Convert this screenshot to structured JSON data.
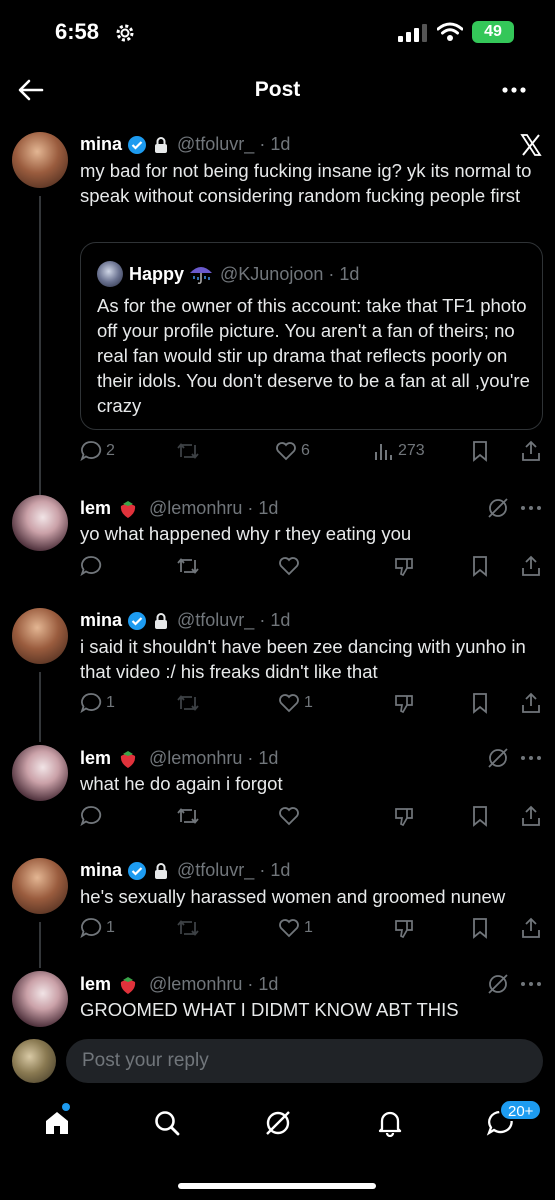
{
  "status": {
    "time": "6:58",
    "battery": "49"
  },
  "header": {
    "title": "Post"
  },
  "tweets": [
    {
      "name": "mina",
      "handle": "@tfoluvr_",
      "time": "1d",
      "text": "my bad for  not being fucking insane ig? yk its normal to speak without considering random fucking people first",
      "quote": {
        "name": "Happy",
        "handle": "@KJunojoon",
        "time": "1d",
        "text": "As for the owner of this account: take that TF1 photo off your profile picture. You aren't a fan of theirs; no real fan would stir up drama that reflects poorly on their idols. You don't deserve to be a fan at all ,you're crazy"
      },
      "replies": "2",
      "likes": "6",
      "views": "273"
    },
    {
      "name": "lem",
      "handle": "@lemonhru",
      "time": "1d",
      "text": "yo what happened why r they eating you"
    },
    {
      "name": "mina",
      "handle": "@tfoluvr_",
      "time": "1d",
      "text": "i said it shouldn't have been zee dancing with yunho in that video :/ his freaks didn't like that",
      "replies": "1",
      "likes": "1"
    },
    {
      "name": "lem",
      "handle": "@lemonhru",
      "time": "1d",
      "text": "what he do again i forgot"
    },
    {
      "name": "mina",
      "handle": "@tfoluvr_",
      "time": "1d",
      "text": "he's sexually harassed women and groomed nunew",
      "replies": "1",
      "likes": "1"
    },
    {
      "name": "lem",
      "handle": "@lemonhru",
      "time": "1d",
      "text": "GROOMED WHAT I DIDMT KNOW ABT THIS"
    }
  ],
  "reply": {
    "placeholder": "Post your reply"
  },
  "nav": {
    "badge": "20+"
  },
  "colors": {
    "accent": "#1d9bf0",
    "muted": "#71767b",
    "battery": "#34c759"
  },
  "icons": [
    "gear-icon",
    "signal-icon",
    "wifi-icon",
    "back-arrow-icon",
    "more-icon",
    "x-logo-icon",
    "verified-icon",
    "lock-icon",
    "strawberry-icon",
    "grok-icon",
    "reply-icon",
    "retweet-icon",
    "like-icon",
    "views-icon",
    "bookmark-icon",
    "share-icon",
    "downvote-icon",
    "home-icon",
    "search-icon",
    "bell-icon",
    "messages-icon"
  ]
}
